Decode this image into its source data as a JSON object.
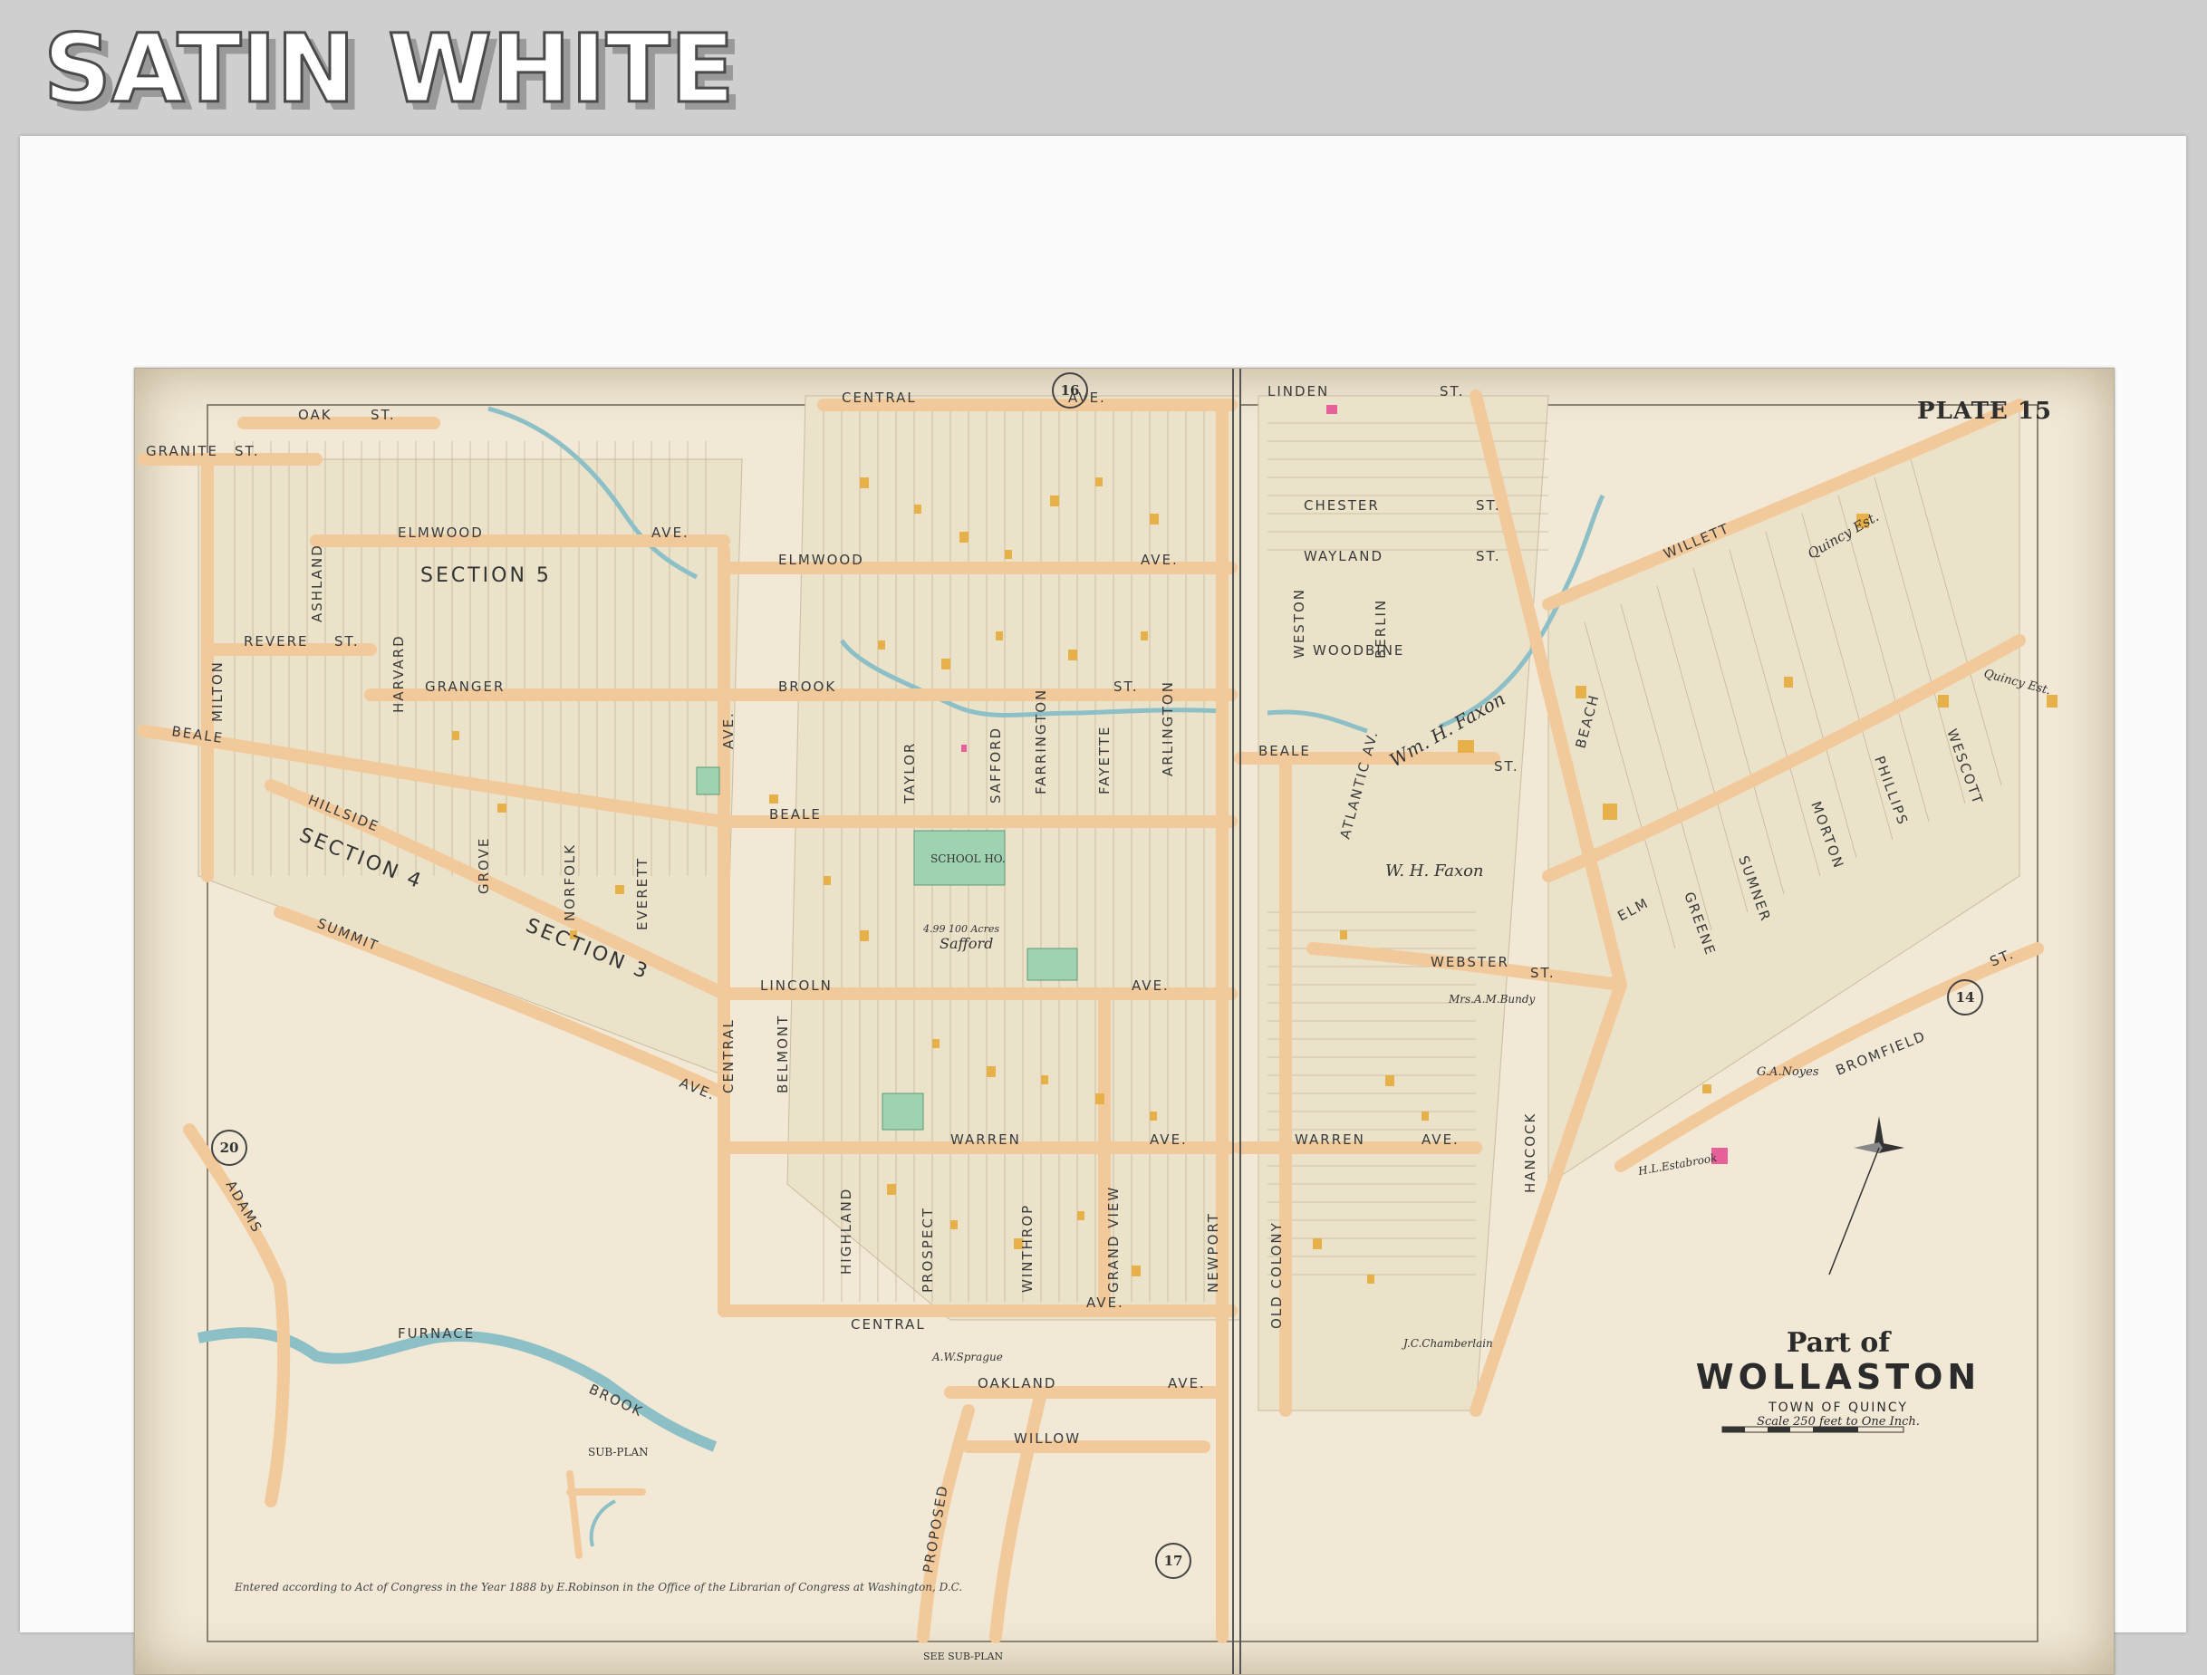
{
  "banner": {
    "text": "SATIN WHITE"
  },
  "map": {
    "plate": "PLATE 15",
    "part_of": "Part of",
    "place": "WOLLASTON",
    "town": "TOWN OF QUINCY",
    "scale": "Scale 250 feet to One Inch.",
    "credit": "Entered according to Act of Congress in the Year 1888 by E.Robinson in the Office of the Librarian of Congress at Washington, D.C.",
    "adjoining_plates": [
      "16",
      "20",
      "14",
      "17"
    ],
    "streets": {
      "central_top": "CENTRAL",
      "ave_top": "AVE.",
      "linden": "LINDEN",
      "st_linden": "ST.",
      "oak": "OAK",
      "st_oak": "ST.",
      "granite": "GRANITE",
      "st_granite": "ST.",
      "elmwood1": "ELMWOOD",
      "ave_elmwood1": "AVE.",
      "elmwood2": "ELMWOOD",
      "ave_elmwood2": "AVE.",
      "revere": "REVERE",
      "st_revere": "ST.",
      "milton": "MILTON",
      "ashland": "ASHLAND",
      "harvard": "HARVARD",
      "granger": "GRANGER",
      "brook": "BROOK",
      "st_brook": "ST.",
      "beale1": "BEALE",
      "beale2": "BEALE",
      "beale3": "BEALE",
      "st_beale3": "ST.",
      "hillside": "HILLSIDE",
      "summit": "SUMMIT",
      "ave_summit": "AVE.",
      "grove": "GROVE",
      "norfolk": "NORFOLK",
      "everett": "EVERETT",
      "central_side": "CENTRAL",
      "ave_central_side": "AVE.",
      "lincoln": "LINCOLN",
      "ave_lincoln": "AVE.",
      "belmont": "BELMONT",
      "warren1": "WARREN",
      "ave_warren1": "AVE.",
      "warren2": "WARREN",
      "ave_warren2": "AVE.",
      "highland": "HIGHLAND",
      "prospect": "PROSPECT",
      "winthrop": "WINTHROP",
      "grand_view": "GRAND VIEW",
      "newport": "NEWPORT",
      "central_bottom": "CENTRAL",
      "ave_central_bottom": "AVE.",
      "oakland": "OAKLAND",
      "ave_oakland": "AVE.",
      "willow": "WILLOW",
      "proposed": "PROPOSED",
      "adams": "ADAMS",
      "furnace": "FURNACE",
      "brook_creek": "BROOK",
      "taylor": "TAYLOR",
      "safford": "SAFFORD",
      "farrington": "FARRINGTON",
      "fayette": "FAYETTE",
      "arlington": "ARLINGTON",
      "chester": "CHESTER",
      "st_chester": "ST.",
      "wayland": "WAYLAND",
      "st_wayland": "ST.",
      "woodbine": "WOODBINE",
      "weston": "WESTON",
      "berlin": "BERLIN",
      "atlantic_av": "ATLANTIC AV.",
      "webster": "WEBSTER",
      "st_webster": "ST.",
      "elm": "ELM",
      "beach": "BEACH",
      "willett": "WILLETT",
      "hancock": "HANCOCK",
      "old_colony": "OLD COLONY",
      "bromfield": "BROMFIELD",
      "st_bromfield": "ST.",
      "wescott": "WESCOTT",
      "phillips": "PHILLIPS",
      "morton": "MORTON",
      "sumner": "SUMNER",
      "greene": "GREENE"
    },
    "sections": [
      "SECTION 5",
      "SECTION 4",
      "SECTION 3"
    ],
    "landmarks": {
      "school": "SCHOOL HO.",
      "safford": "Safford",
      "acres": "4.99 100 Acres",
      "faxon1": "Wm. H. Faxon",
      "faxon2": "W. H. Faxon",
      "quincy_est": "Quincy Est.",
      "noyes": "G.A.Noyes",
      "estabrook": "H.L.Estabrook",
      "chamberlain": "J.C.Chamberlain",
      "sprague": "A.W.Sprague",
      "bundy": "Mrs.A.M.Bundy",
      "subplan": "SUB-PLAN",
      "see_subplan": "SEE SUB-PLAN"
    },
    "colors": {
      "paper": "#f1e9d6",
      "road": "#f2c99a",
      "road_edge": "#d7a67a",
      "water": "#a9cfd4",
      "building": "#e8b048",
      "green_lot": "#9fd2b0",
      "pink_lot": "#e8609a"
    }
  }
}
